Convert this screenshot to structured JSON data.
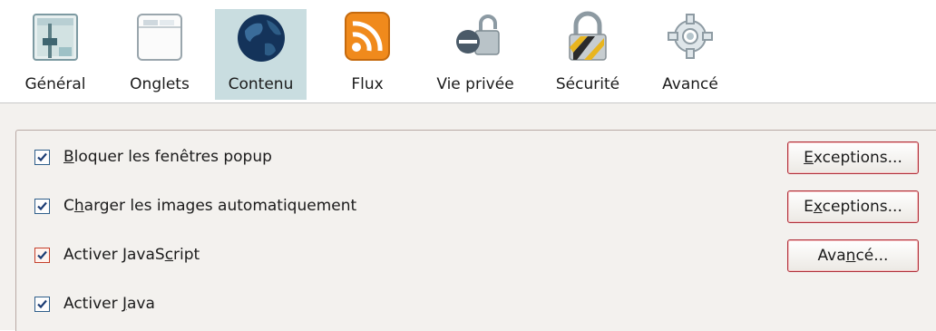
{
  "tabs": [
    {
      "label": "Général",
      "icon": "general-settings-icon"
    },
    {
      "label": "Onglets",
      "icon": "tabs-window-icon"
    },
    {
      "label": "Contenu",
      "icon": "globe-icon",
      "selected": true
    },
    {
      "label": "Flux",
      "icon": "rss-feed-icon"
    },
    {
      "label": "Vie privée",
      "icon": "privacy-mask-lock-icon"
    },
    {
      "label": "Sécurité",
      "icon": "padlock-icon"
    },
    {
      "label": "Avancé",
      "icon": "gear-icon"
    }
  ],
  "options": [
    {
      "pre": "",
      "acc": "B",
      "post": "loquer les fenêtres popup",
      "checked": true
    },
    {
      "pre": "C",
      "acc": "h",
      "post": "arger les images automatiquement",
      "checked": true
    },
    {
      "pre": "Activer JavaS",
      "acc": "c",
      "post": "ript",
      "checked": true
    },
    {
      "pre": "Activer ",
      "acc": "J",
      "post": "ava",
      "checked": true
    }
  ],
  "buttons": [
    {
      "pre": "",
      "acc": "E",
      "post": "xceptions..."
    },
    {
      "pre": "E",
      "acc": "x",
      "post": "ceptions..."
    },
    {
      "pre": "Ava",
      "acc": "n",
      "post": "cé..."
    }
  ],
  "colors": {
    "selected_tab_bg": "#c9dde0",
    "button_focus_border": "#b0303a",
    "checkbox_border": "#2f5f8a"
  }
}
